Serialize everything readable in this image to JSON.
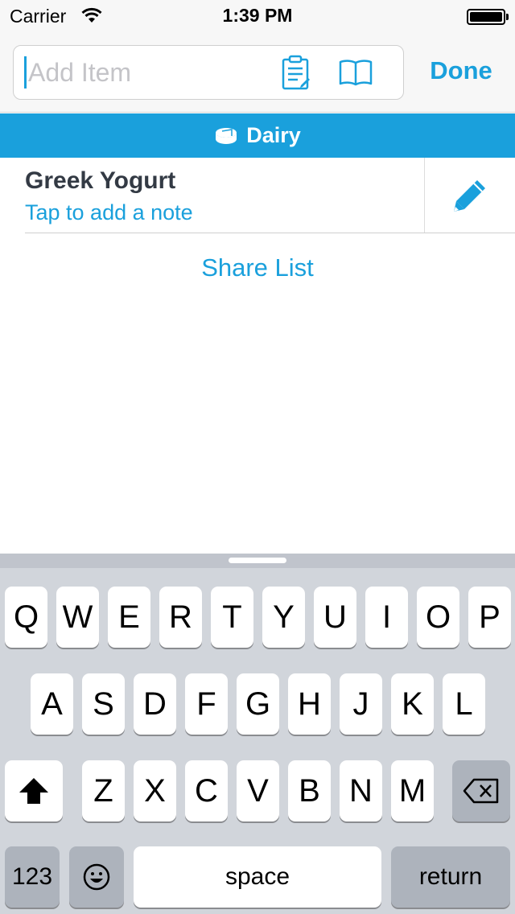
{
  "status_bar": {
    "carrier": "Carrier",
    "time": "1:39 PM",
    "battery_level": 1.0
  },
  "top_bar": {
    "add_item_placeholder": "Add Item",
    "add_item_value": "",
    "icons": [
      "clipboard-icon",
      "book-icon"
    ],
    "done_label": "Done"
  },
  "category": {
    "name": "Dairy",
    "icon": "dairy-icon",
    "color": "#1aa0dc"
  },
  "items": [
    {
      "name": "Greek Yogurt",
      "note_prompt": "Tap to add a note",
      "action_icon": "pencil-icon"
    }
  ],
  "share_list_label": "Share List",
  "keyboard": {
    "row1": [
      "Q",
      "W",
      "E",
      "R",
      "T",
      "Y",
      "U",
      "I",
      "O",
      "P"
    ],
    "row2": [
      "A",
      "S",
      "D",
      "F",
      "G",
      "H",
      "J",
      "K",
      "L"
    ],
    "row3": [
      "Z",
      "X",
      "C",
      "V",
      "B",
      "N",
      "M"
    ],
    "numbers_label": "123",
    "space_label": "space",
    "return_label": "return",
    "shift_icon": "shift-icon",
    "delete_icon": "delete-icon",
    "emoji_icon": "emoji-icon"
  },
  "colors": {
    "accent": "#1aa0dc",
    "item_text": "#333a44",
    "keyboard_bg": "#d1d5db"
  }
}
